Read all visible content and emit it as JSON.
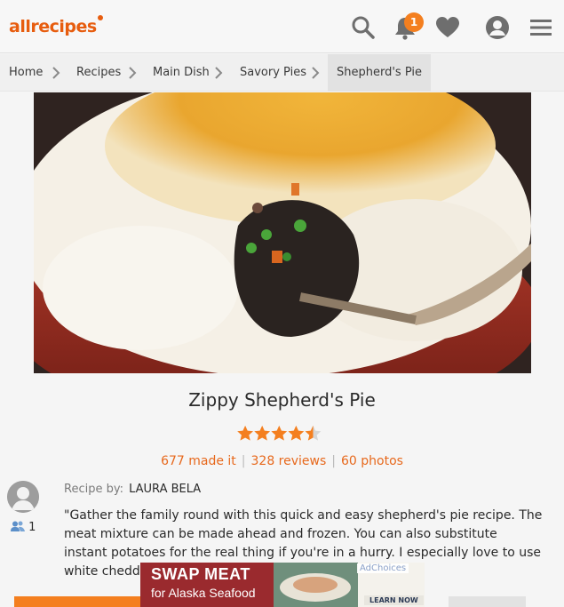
{
  "header": {
    "logo": "allrecipes",
    "notification_count": "1",
    "icons": [
      "search-icon",
      "bell-icon",
      "heart-icon",
      "profile-icon",
      "hamburger-menu-icon"
    ],
    "accent_color": "#e75d0f"
  },
  "breadcrumb": [
    "Home",
    "Recipes",
    "Main Dish",
    "Savory Pies",
    "Shepherd's Pie"
  ],
  "recipe": {
    "title": "Zippy Shepherd's Pie",
    "rating": 4.5,
    "made_it": "677 made it",
    "reviews": "328 reviews",
    "photos": "60 photos",
    "recipe_by_label": "Recipe by:",
    "author": "LAURA BELA",
    "followers": "1",
    "description": "\"Gather the family round with this quick and easy shepherd's pie recipe. The meat mixture can be made ahead and frozen. You can also substitute instant potatoes for the real thing if you're in a hurry. I especially love to use white cheddar in th"
  },
  "ad": {
    "headline": "SWAP MEAT",
    "subline": "for Alaska Seafood",
    "adchoices": "AdChoices",
    "cta": "LEARN NOW"
  }
}
